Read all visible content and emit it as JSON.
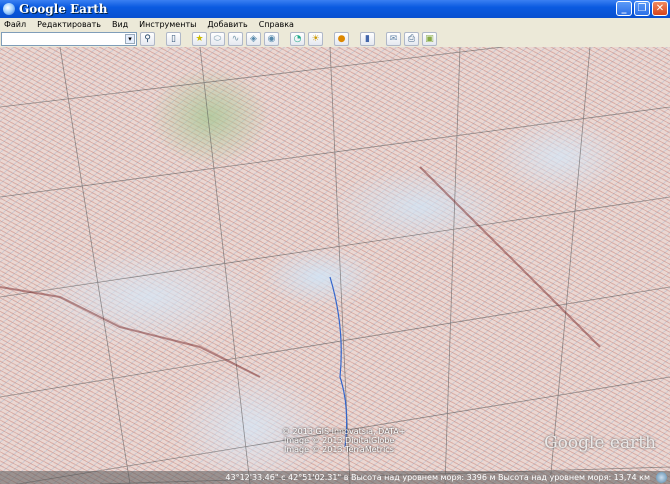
{
  "window": {
    "title": "Google Earth"
  },
  "menu": [
    "Файл",
    "Редактировать",
    "Вид",
    "Инструменты",
    "Добавить",
    "Справка"
  ],
  "search": {
    "value": ""
  },
  "toolbar": {
    "icons": [
      "search-icon",
      "sidebar-icon",
      "placemark-icon",
      "polygon-icon",
      "path-icon",
      "image-overlay-icon",
      "tour-icon",
      "historical-imagery-icon",
      "sunlight-icon",
      "planet-icon",
      "ruler-icon",
      "email-icon",
      "print-icon",
      "save-image-icon"
    ]
  },
  "attribution": [
    "© 2013 GIS Innovatsia, DATA+",
    "Image © 2013 DigitalGlobe",
    "Image © 2013 TerraMetrics"
  ],
  "logo": "Google earth",
  "status": {
    "text": "43°12'33.46\" с  42°51'02.31\" в  Высота над уровнем моря: 3396 м  Высота над уровнем моря:   13,74 км"
  }
}
